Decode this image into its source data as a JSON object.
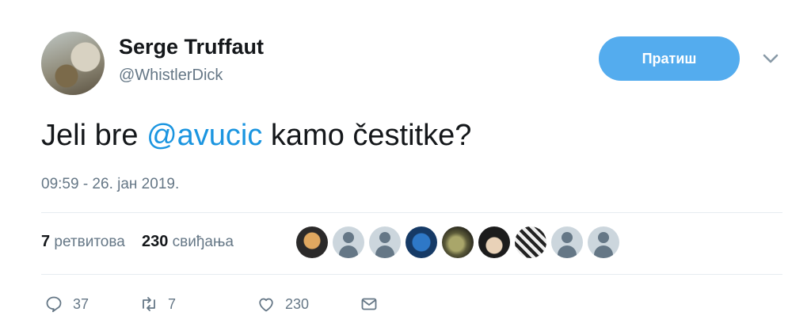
{
  "user": {
    "name": "Serge Truffaut",
    "handle": "@WhistlerDick"
  },
  "follow_button": {
    "label": "Пратиш"
  },
  "tweet": {
    "text_before": "Jeli bre ",
    "mention": "@avucic",
    "text_after": " kamo čestitke?",
    "timestamp": "09:59 - 26. јан 2019."
  },
  "stats": {
    "retweets_count": "7",
    "retweets_label": "ретвитова",
    "likes_count": "230",
    "likes_label": "свиђања"
  },
  "likers": [
    "photo",
    "default",
    "default",
    "photo",
    "photo",
    "photo",
    "photo",
    "default",
    "default"
  ],
  "actions": {
    "replies": "37",
    "retweets": "7",
    "likes": "230"
  },
  "colors": {
    "accent": "#1b95e0",
    "button": "#54acee",
    "secondary_text": "#657786"
  },
  "icons": [
    "chevron-down-icon",
    "reply-icon",
    "retweet-icon",
    "heart-icon",
    "message-icon"
  ]
}
